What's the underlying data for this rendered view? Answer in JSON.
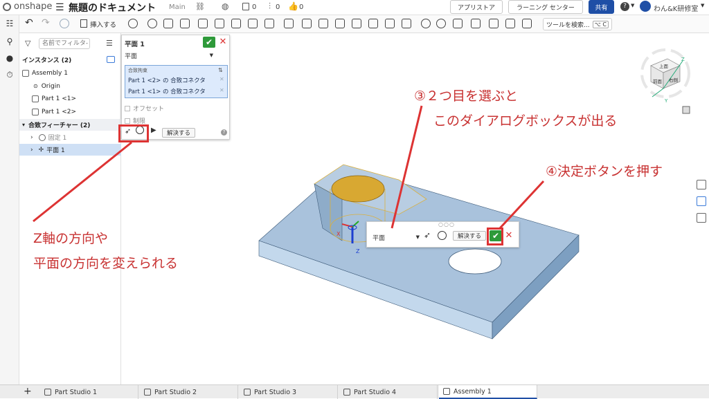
{
  "app": {
    "logo_text": "onshape",
    "doc_title": "無題のドキュメント",
    "branch": "Main",
    "counts": {
      "a": "0",
      "b": "0",
      "c": "0"
    },
    "app_store": "アプリストア",
    "learning_center": "ラーニング センター",
    "share": "共有",
    "user": "わん&K研修室"
  },
  "toolbar": {
    "insert_label": "挿入する",
    "search_tools": "ツールを検索...",
    "search_shortcut": "⌥ C"
  },
  "features": {
    "filter_placeholder": "名前でフィルタ-",
    "instances_header": "インスタンス (2)",
    "rows": [
      {
        "label": "Assembly 1"
      },
      {
        "label": "Origin"
      },
      {
        "label": "Part 1 <1>"
      },
      {
        "label": "Part 1 <2>"
      }
    ],
    "mate_header": "合致フィーチャー (2)",
    "mates": [
      {
        "label": "固定 1"
      },
      {
        "label": "平面 1"
      }
    ]
  },
  "dialog": {
    "title": "平面 1",
    "type_value": "平面",
    "mate_connectors_label": "合致拘束",
    "mate_rows": [
      "Part 1 <2> の 合致コネクタ",
      "Part 1 <1> の 合致コネクタ"
    ],
    "offset_label": "オフセット",
    "limits_label": "制限",
    "resolve_label": "解決する"
  },
  "mini_dialog": {
    "type_value": "平面",
    "resolve_label": "解決する"
  },
  "annotations": {
    "step3_line1": "③２つ目を選ぶと",
    "step3_line2": "このダイアログボックスが出る",
    "step4": "④決定ボタンを押す",
    "note_line1": "Z軸の方向や",
    "note_line2": "平面の方向を変えられる"
  },
  "view_cube": {
    "top": "上面",
    "front": "前面",
    "right": "右側",
    "axis_z": "Z",
    "axis_y": "Y",
    "axis_x": "X"
  },
  "triad": {
    "x": "X",
    "z": "Z"
  },
  "tabs": [
    {
      "label": "Part Studio 1"
    },
    {
      "label": "Part Studio 2"
    },
    {
      "label": "Part Studio 3"
    },
    {
      "label": "Part Studio 4"
    },
    {
      "label": "Assembly 1"
    }
  ],
  "colors": {
    "accent": "#1f4fa6",
    "confirm": "#2e9a3a",
    "annotation": "#c83232",
    "part_fill": "#a9c2dc",
    "hole_gold": "#d8a832"
  }
}
